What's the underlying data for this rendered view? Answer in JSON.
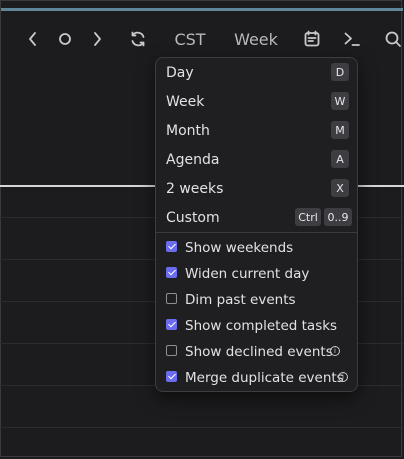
{
  "toolbar": {
    "tz_label": "CST",
    "view_label": "Week"
  },
  "menu": {
    "views": [
      {
        "label": "Day",
        "keys": [
          "D"
        ]
      },
      {
        "label": "Week",
        "keys": [
          "W"
        ]
      },
      {
        "label": "Month",
        "keys": [
          "M"
        ]
      },
      {
        "label": "Agenda",
        "keys": [
          "A"
        ]
      },
      {
        "label": "2 weeks",
        "keys": [
          "X"
        ]
      },
      {
        "label": "Custom",
        "keys": [
          "Ctrl",
          "0..9"
        ]
      }
    ],
    "options": [
      {
        "label": "Show weekends",
        "checked": true,
        "info": false
      },
      {
        "label": "Widen current day",
        "checked": true,
        "info": false
      },
      {
        "label": "Dim past events",
        "checked": false,
        "info": false
      },
      {
        "label": "Show completed tasks",
        "checked": true,
        "info": false
      },
      {
        "label": "Show declined events",
        "checked": false,
        "info": true
      },
      {
        "label": "Merge duplicate events",
        "checked": true,
        "info": true
      }
    ]
  },
  "colors": {
    "accent": "#6b6cf0",
    "top_strip": "#5e8598",
    "background": "#1c1c1e"
  }
}
